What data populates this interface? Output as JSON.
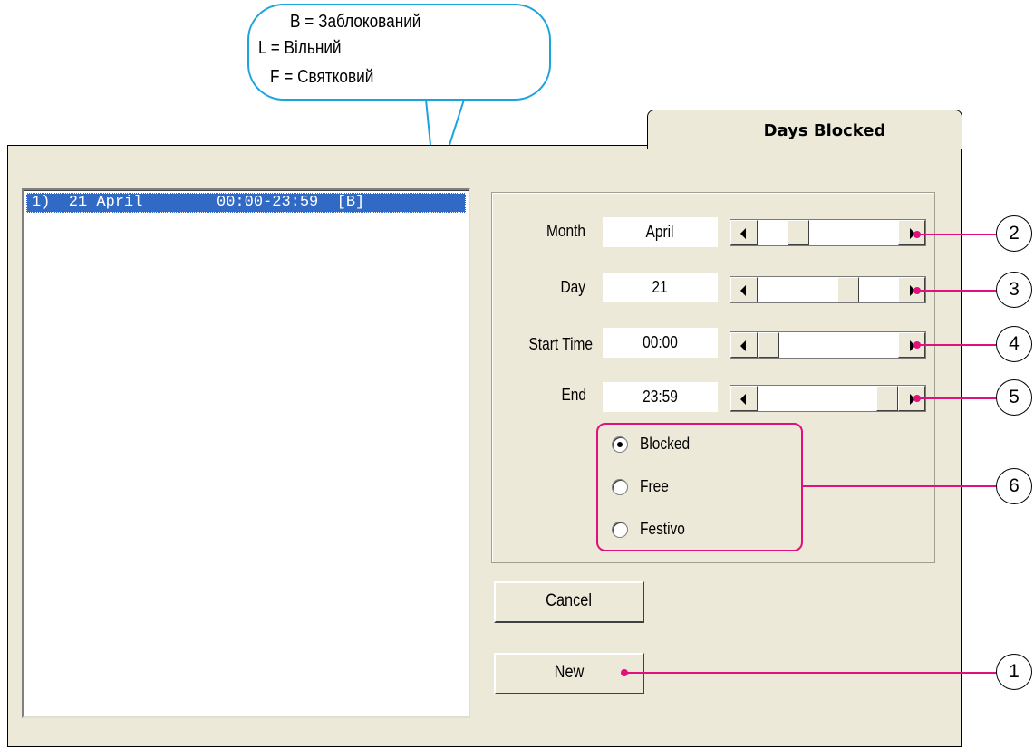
{
  "legend": {
    "line1": "B = Заблокований",
    "line2": "L = Вільний",
    "line3": "F = Святковий"
  },
  "tab": {
    "title": "Days Blocked"
  },
  "list": {
    "rows": [
      "1)  21 April        00:00-23:59  [B]"
    ]
  },
  "form": {
    "month": {
      "label": "Month",
      "value": "April",
      "slider_fraction": 0.25
    },
    "day": {
      "label": "Day",
      "value": "21",
      "slider_fraction": 0.67
    },
    "start_time": {
      "label": "Start Time",
      "value": "00:00",
      "slider_fraction": 0.0
    },
    "end_time": {
      "label": "End",
      "value": "23:59",
      "slider_fraction": 1.0
    }
  },
  "radio": {
    "options": [
      "Blocked",
      "Free",
      "Festivo"
    ],
    "selected": "Blocked"
  },
  "buttons": {
    "cancel": "Cancel",
    "new": "New"
  },
  "callouts": {
    "new": "1",
    "month": "2",
    "day": "3",
    "start_time": "4",
    "end_time": "5",
    "radio_group": "6"
  },
  "colors": {
    "accent": "#e0117d",
    "bubble_border": "#1ba3de",
    "selection": "#316ac5",
    "dialog_bg": "#ece9d8"
  }
}
